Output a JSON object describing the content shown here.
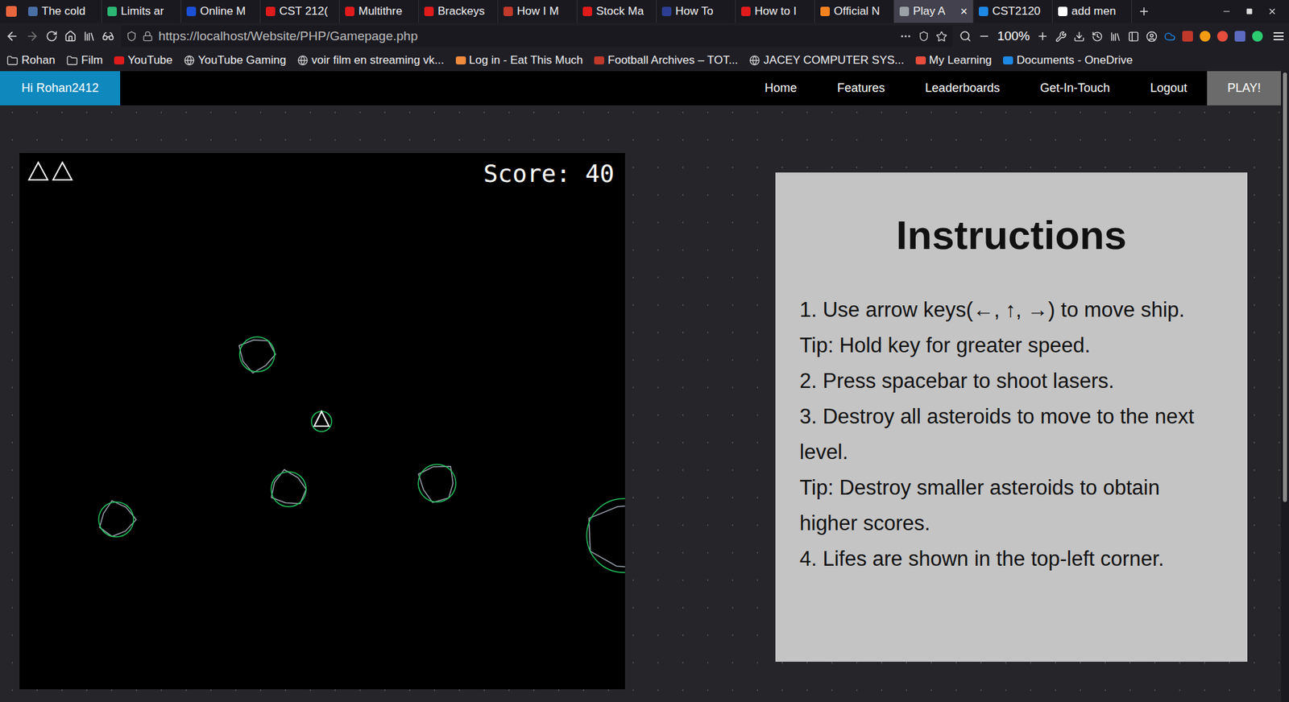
{
  "browser": {
    "tabs": [
      {
        "label": "The cold",
        "selected": false,
        "color": "#4a6fa5"
      },
      {
        "label": "Limits ar",
        "selected": false,
        "color": "#2bb673"
      },
      {
        "label": "Online M",
        "selected": false,
        "color": "#1a4fd6"
      },
      {
        "label": "CST 212(",
        "selected": false,
        "color": "#e01b1b"
      },
      {
        "label": "Multithre",
        "selected": false,
        "color": "#e01b1b"
      },
      {
        "label": "Brackeys",
        "selected": false,
        "color": "#e01b1b"
      },
      {
        "label": "How I M",
        "selected": false,
        "color": "#c0392b"
      },
      {
        "label": "Stock Ma",
        "selected": false,
        "color": "#e01b1b"
      },
      {
        "label": "How To",
        "selected": false,
        "color": "#2c3e91"
      },
      {
        "label": "How to I",
        "selected": false,
        "color": "#e01b1b"
      },
      {
        "label": "Official N",
        "selected": false,
        "color": "#f58220"
      },
      {
        "label": "Play A",
        "selected": true,
        "color": "#9aa0a6"
      },
      {
        "label": "CST2120",
        "selected": false,
        "color": "#1e88e5"
      },
      {
        "label": "add men",
        "selected": false,
        "color": "#ffffff"
      }
    ],
    "close_tab": "×",
    "url": "https://localhost/Website/PHP/Gamepage.php",
    "zoom": "100%",
    "bookmarks": [
      {
        "label": "Rohan",
        "kind": "folder",
        "color": "#cccccc"
      },
      {
        "label": "Film",
        "kind": "folder",
        "color": "#cccccc"
      },
      {
        "label": "YouTube",
        "kind": "site",
        "color": "#e01b1b"
      },
      {
        "label": "YouTube Gaming",
        "kind": "globe",
        "color": "#cccccc"
      },
      {
        "label": "voir film en streaming vk...",
        "kind": "globe",
        "color": "#cccccc"
      },
      {
        "label": "Log in - Eat This Much",
        "kind": "site",
        "color": "#f08a3c"
      },
      {
        "label": "Football Archives – TOT...",
        "kind": "site",
        "color": "#c0392b"
      },
      {
        "label": "JACEY COMPUTER SYS...",
        "kind": "globe",
        "color": "#cccccc"
      },
      {
        "label": "My Learning",
        "kind": "site",
        "color": "#e74c3c"
      },
      {
        "label": "Documents - OneDrive",
        "kind": "site",
        "color": "#1e88e5"
      }
    ]
  },
  "site": {
    "greeting": "Hi Rohan2412",
    "nav": [
      {
        "label": "Home",
        "selected": false
      },
      {
        "label": "Features",
        "selected": false
      },
      {
        "label": "Leaderboards",
        "selected": false
      },
      {
        "label": "Get-In-Touch",
        "selected": false
      },
      {
        "label": "Logout",
        "selected": false
      },
      {
        "label": "PLAY!",
        "selected": true
      }
    ]
  },
  "game": {
    "lives": 2,
    "score": "Score: 40"
  },
  "instructions": {
    "title": "Instructions",
    "lines": [
      "1. Use arrow keys(←, ↑, →) to move ship.",
      "Tip: Hold key for greater speed.",
      "2. Press spacebar to shoot lasers.",
      "3. Destroy all asteroids to move to the next level.",
      "Tip: Destroy smaller asteroids to obtain higher scores.",
      "4. Lifes are shown in the top-left corner."
    ]
  }
}
